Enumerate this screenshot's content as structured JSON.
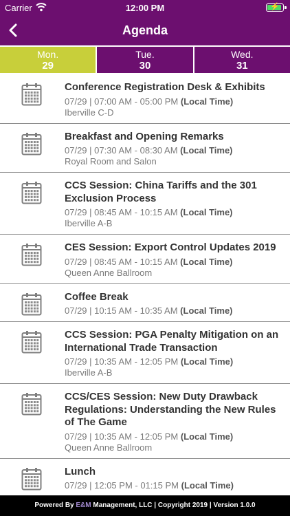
{
  "status": {
    "carrier": "Carrier",
    "time": "12:00 PM",
    "battery_level": 0.9
  },
  "header": {
    "title": "Agenda"
  },
  "tabs": [
    {
      "dow": "Mon.",
      "day": "29",
      "active": true
    },
    {
      "dow": "Tue.",
      "day": "30",
      "active": false
    },
    {
      "dow": "Wed.",
      "day": "31",
      "active": false
    }
  ],
  "sessions": [
    {
      "title": "Conference Registration Desk & Exhibits",
      "time": "07/29 | 07:00 AM - 05:00 PM",
      "tz": "(Local Time)",
      "location": "Iberville C-D"
    },
    {
      "title": "Breakfast and Opening Remarks",
      "time": "07/29 | 07:30 AM - 08:30 AM",
      "tz": "(Local Time)",
      "location": "Royal Room and Salon"
    },
    {
      "title": "CCS Session: China Tariffs and the 301 Exclusion Process",
      "time": "07/29 | 08:45 AM - 10:15 AM",
      "tz": "(Local Time)",
      "location": "Iberville A-B"
    },
    {
      "title": "CES Session: Export Control Updates 2019",
      "time": "07/29 | 08:45 AM - 10:15 AM",
      "tz": "(Local Time)",
      "location": "Queen Anne Ballroom"
    },
    {
      "title": "Coffee Break",
      "time": "07/29 | 10:15 AM - 10:35 AM",
      "tz": "(Local Time)",
      "location": ""
    },
    {
      "title": "CCS Session: PGA Penalty Mitigation on an International Trade Transaction",
      "time": "07/29 | 10:35 AM - 12:05 PM",
      "tz": "(Local Time)",
      "location": "Iberville A-B"
    },
    {
      "title": "CCS/CES Session: New Duty Drawback Regulations: Understanding the New Rules of The Game",
      "time": "07/29 | 10:35 AM - 12:05 PM",
      "tz": "(Local Time)",
      "location": "Queen Anne Ballroom"
    },
    {
      "title": "Lunch",
      "time": "07/29 | 12:05 PM - 01:15 PM",
      "tz": "(Local Time)",
      "location": ""
    }
  ],
  "footer": {
    "prefix": "Powered By ",
    "brand": "E&M",
    "suffix": " Management, LLC | Copyright 2019 | Version 1.0.0"
  }
}
